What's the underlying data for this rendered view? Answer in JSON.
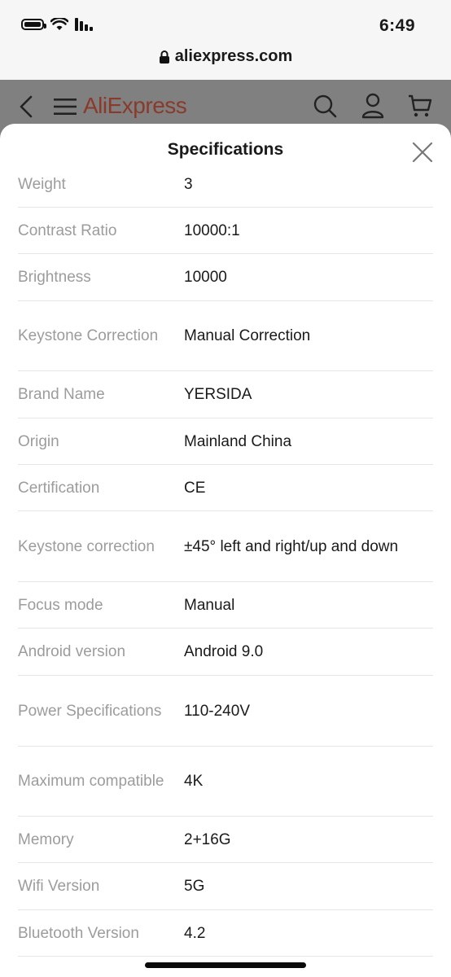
{
  "status_bar": {
    "time": "6:49"
  },
  "browser": {
    "url": "aliexpress.com"
  },
  "app_header": {
    "logo": "AliExpress"
  },
  "sheet": {
    "title": "Specifications",
    "specs": [
      {
        "label": "Weight",
        "value": "3"
      },
      {
        "label": "Contrast Ratio",
        "value": "10000:1"
      },
      {
        "label": "Brightness",
        "value": "10000"
      },
      {
        "label": "Keystone Correction",
        "value": "Manual Correction"
      },
      {
        "label": "Brand Name",
        "value": "YERSIDA"
      },
      {
        "label": "Origin",
        "value": "Mainland China"
      },
      {
        "label": "Certification",
        "value": "CE"
      },
      {
        "label": "Keystone correction",
        "value": "±45° left and right/up and down"
      },
      {
        "label": "Focus mode",
        "value": "Manual"
      },
      {
        "label": "Android version",
        "value": "Android 9.0"
      },
      {
        "label": "Power Specifications",
        "value": "110-240V"
      },
      {
        "label": "Maximum compatible",
        "value": "4K"
      },
      {
        "label": "Memory",
        "value": "2+16G"
      },
      {
        "label": "Wifi Version",
        "value": "5G"
      },
      {
        "label": "Bluetooth Version",
        "value": "4.2"
      }
    ]
  },
  "icons": {
    "back": "chevron-left-icon",
    "menu": "hamburger-menu-icon",
    "search": "search-icon",
    "account": "user-icon",
    "cart": "cart-icon",
    "close": "close-icon",
    "lock": "lock-icon"
  },
  "colors": {
    "brand": "#e43225",
    "label_gray": "#9c9c9c",
    "overlay": "#808080"
  }
}
